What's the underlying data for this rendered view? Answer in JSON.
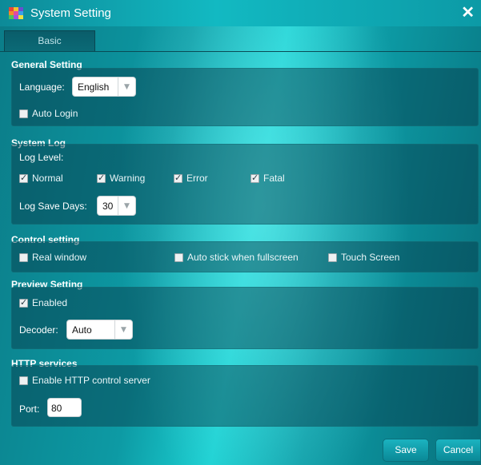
{
  "window": {
    "title": "System Setting",
    "close_label": "✕"
  },
  "tabs": [
    {
      "label": "Basic",
      "active": true
    }
  ],
  "general": {
    "title": "General Setting",
    "language_label": "Language:",
    "language_value": "English",
    "auto_login_label": "Auto Login",
    "auto_login_checked": false
  },
  "system_log": {
    "title": "System Log",
    "log_level_label": "Log Level:",
    "levels": [
      {
        "label": "Normal",
        "checked": true
      },
      {
        "label": "Warning",
        "checked": true
      },
      {
        "label": "Error",
        "checked": true
      },
      {
        "label": "Fatal",
        "checked": true
      }
    ],
    "save_days_label": "Log Save Days:",
    "save_days_value": "30"
  },
  "control": {
    "title": "Control setting",
    "options": [
      {
        "label": "Real window",
        "checked": false
      },
      {
        "label": "Auto stick when fullscreen",
        "checked": false
      },
      {
        "label": "Touch Screen",
        "checked": false
      }
    ]
  },
  "preview": {
    "title": "Preview Setting",
    "enabled_label": "Enabled",
    "enabled_checked": true,
    "decoder_label": "Decoder:",
    "decoder_value": "Auto"
  },
  "http": {
    "title": "HTTP services",
    "enable_label": "Enable HTTP control server",
    "enable_checked": false,
    "port_label": "Port:",
    "port_value": "80"
  },
  "footer": {
    "save_label": "Save",
    "cancel_label": "Cancel"
  },
  "icons": {
    "dropdown_arrow": "▼",
    "app_icon": "app-icon",
    "close_icon": "close-icon"
  },
  "colors": {
    "accent": "#12b9c2",
    "panel": "#063746",
    "button": "#1bb3c0"
  }
}
